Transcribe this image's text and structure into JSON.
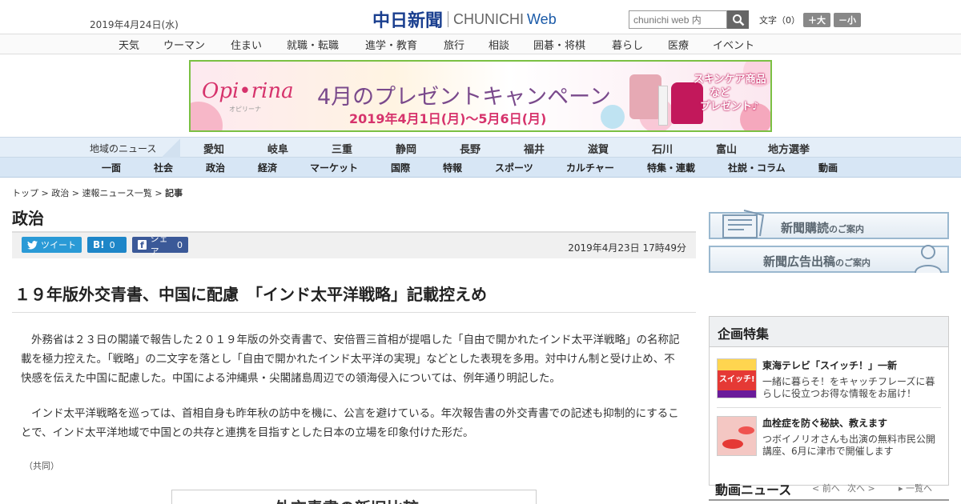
{
  "header": {
    "date": "2019年4月24日(水)",
    "logo_kanji": "中日新聞",
    "logo_en": "CHUNICHI",
    "logo_web": "Web",
    "search_placeholder": "chunichi web 内",
    "fontsize_label": "文字（0）",
    "font_up": "＋大",
    "font_down": "－小"
  },
  "top_nav": [
    "天気",
    "ウーマン",
    "住まい",
    "就職・転職",
    "進学・教育",
    "旅行",
    "相談",
    "囲碁・将棋",
    "暮らし",
    "医療",
    "イベント"
  ],
  "banner": {
    "brand": "Opi•rina",
    "brand_sub": "オピリーナ",
    "title": "4月のプレゼントキャンペーン",
    "dates": "2019年4月1日(月)～5月6日(月)",
    "badge_line1": "スキンケア商品",
    "badge_line2": "など",
    "badge_line3": "プレゼント♪",
    "accent": "#7bc043"
  },
  "region_nav": {
    "label": "地域のニュース",
    "items": [
      "愛知",
      "岐阜",
      "三重",
      "静岡",
      "長野",
      "福井",
      "滋賀",
      "石川",
      "富山",
      "地方選挙"
    ]
  },
  "genre_nav": [
    "一面",
    "社会",
    "政治",
    "経済",
    "マーケット",
    "国際",
    "特報",
    "スポーツ",
    "カルチャー",
    "特集・連載",
    "社説・コラム",
    "動画"
  ],
  "breadcrumb": {
    "top": "トップ",
    "politics": "政治",
    "list": "速報ニュース一覧",
    "current": "記事",
    "sep": ">"
  },
  "section_title": "政治",
  "share": {
    "tweet": "ツイート",
    "hatena_label": "B!",
    "hatena_count": "0",
    "fb_label": "シェア",
    "fb_count": "0",
    "pubdate": "2019年4月23日 17時49分"
  },
  "article": {
    "headline": "１９年版外交青書、中国に配慮　「インド太平洋戦略」記載控えめ",
    "para1": "外務省は２３日の閣議で報告した２０１９年版の外交青書で、安倍晋三首相が提唱した「自由で開かれたインド太平洋戦略」の名称記載を極力控えた。「戦略」の二文字を落とし「自由で開かれたインド太平洋の実現」などとした表現を多用。対中けん制と受け止め、不快感を伝えた中国に配慮した。中国による沖縄県・尖閣諸島周辺での領海侵入については、例年通り明記した。",
    "para2": "インド太平洋戦略を巡っては、首相自身も昨年秋の訪中を機に、公言を避けている。年次報告書の外交青書での記述も抑制的にすることで、インド太平洋地域で中国との共存と連携を目指すとした日本の立場を印象付けた形だ。",
    "credit": "（共同）",
    "figure_title": "外交青書の新旧比較"
  },
  "sidebar": {
    "subscribe": "新聞購読",
    "subscribe_small": "のご案内",
    "ad": "新聞広告出稿",
    "ad_small": "のご案内",
    "kikaku_title": "企画特集",
    "items": [
      {
        "title": "東海テレビ「スイッチ！」一新",
        "desc": "一緒に暮らそ！をキャッチフレーズに暮らしに役立つお得な情報をお届け！",
        "thumb_text": "スイッチ!"
      },
      {
        "title": "血栓症を防ぐ秘訣、教えます",
        "desc": "つボイノリオさんも出演の無料市民公開講座、6月に津市で開催します",
        "thumb_text": ""
      }
    ],
    "video_title": "動画ニュース",
    "video_prev": "< 前へ",
    "video_next": "次へ >",
    "video_list": "一覧へ"
  }
}
